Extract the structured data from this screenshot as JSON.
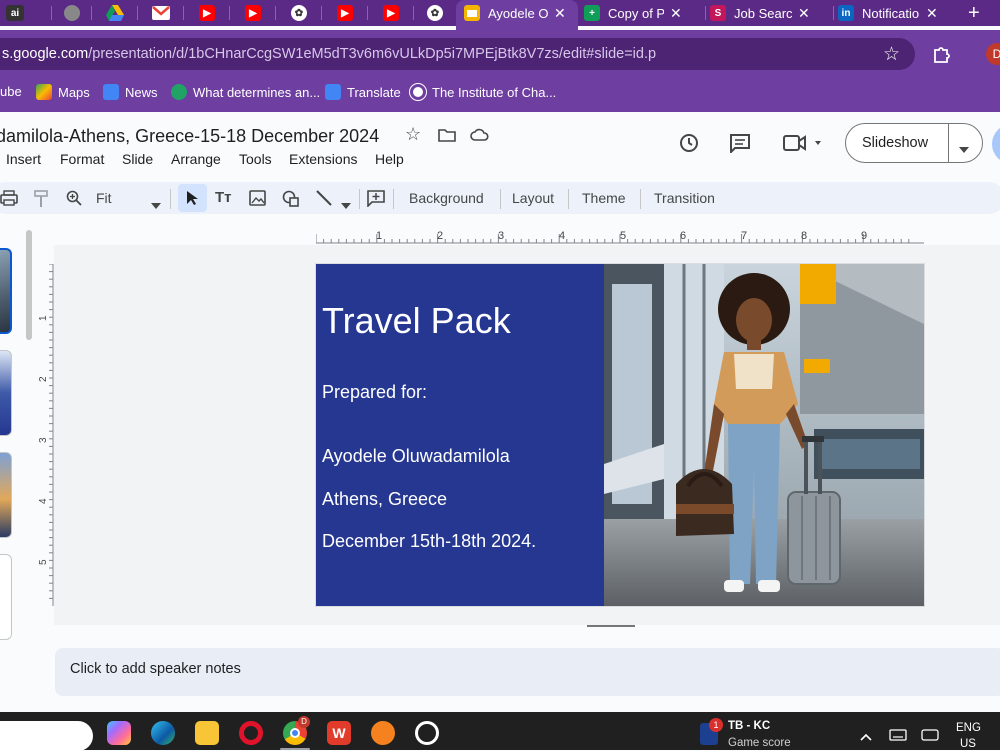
{
  "tabs": [
    {
      "label": ""
    },
    {
      "label": ""
    },
    {
      "label": ""
    },
    {
      "label": ""
    },
    {
      "label": ""
    },
    {
      "label": ""
    },
    {
      "label": ""
    },
    {
      "label": ""
    },
    {
      "label": ""
    },
    {
      "label": "Ayodele O"
    },
    {
      "label": "Copy of Pe"
    },
    {
      "label": "Job Search"
    },
    {
      "label": "Notificatio"
    }
  ],
  "address": {
    "domain": "s.google.com",
    "path": "/presentation/d/1bCHnarCcgSW1eM5dT3v6m6vULkDp5i7MPEjBtk8V7zs/edit#slide=id.p"
  },
  "bookmarks": [
    "ube",
    "Maps",
    "News",
    "What determines an...",
    "Translate",
    "The Institute of Cha..."
  ],
  "doc": {
    "title": "damilola-Athens, Greece-15-18 December 2024",
    "menus": [
      "Insert",
      "Format",
      "Slide",
      "Arrange",
      "Tools",
      "Extensions",
      "Help"
    ],
    "slideshow_label": "Slideshow"
  },
  "toolbar": {
    "zoom": "Fit",
    "background": "Background",
    "layout": "Layout",
    "theme": "Theme",
    "transition": "Transition"
  },
  "ruler": {
    "top": [
      "1",
      "2",
      "3",
      "4",
      "5",
      "6",
      "7",
      "8",
      "9"
    ],
    "left": [
      "1",
      "2",
      "3",
      "4",
      "5"
    ]
  },
  "slide": {
    "title": "Travel Pack",
    "prepared_for": "Prepared for:",
    "name": "Ayodele Oluwadamilola",
    "place": "Athens, Greece",
    "dates": "December 15th-18th 2024.",
    "left_color": "#253791"
  },
  "notes": {
    "placeholder": "Click to add speaker notes"
  },
  "taskbar": {
    "notify_count": "1",
    "widget_title": "TB - KC",
    "widget_sub": "Game score",
    "lang_top": "ENG",
    "lang_bottom": "US"
  },
  "colors": {
    "browser": "#6e3ea0",
    "tabbar": "#5b2a86",
    "accent": "#0b57d0"
  }
}
